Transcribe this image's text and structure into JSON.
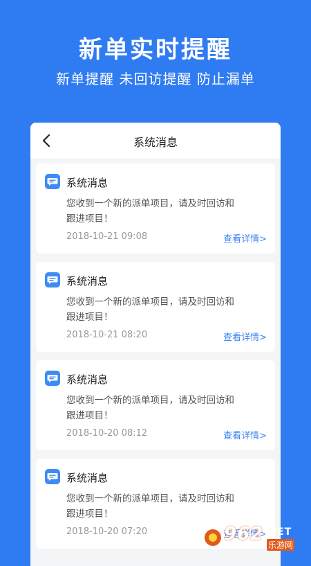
{
  "promo": {
    "title": "新单实时提醒",
    "subtitle": "新单提醒  未回访提醒  防止漏单"
  },
  "navbar": {
    "title": "系统消息"
  },
  "messages": [
    {
      "title": "系统消息",
      "body": "您收到一个新的派单项目，请及时回访和跟进项目！",
      "time": "2018-10-21 09:08",
      "link": "查看详情>"
    },
    {
      "title": "系统消息",
      "body": "您收到一个新的派单项目，请及时回访和跟进项目！",
      "time": "2018-10-21 08:20",
      "link": "查看详情>"
    },
    {
      "title": "系统消息",
      "body": "您收到一个新的派单项目，请及时回访和跟进项目！",
      "time": "2018-10-20 08:12",
      "link": "查看详情>"
    },
    {
      "title": "系统消息",
      "body": "您收到一个新的派单项目，请及时回访和跟进项目！",
      "time": "2018-10-20 07:20",
      "link": "查看详情>"
    }
  ],
  "watermark": {
    "number": "962",
    "net": ".NET",
    "site": "乐游网"
  },
  "colors": {
    "background": "#2f7bf2",
    "accent": "#3b82f0",
    "icon": "#3d8bf5"
  },
  "icons": {
    "back": "chevron-left-icon",
    "message": "chat-bubble-icon"
  }
}
